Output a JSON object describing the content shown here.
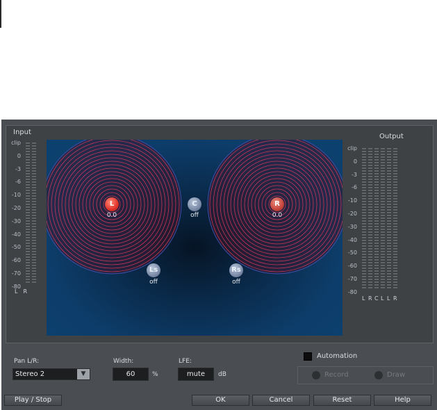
{
  "input": {
    "title": "Input",
    "scale": [
      "clip",
      "0",
      "-3",
      "-6",
      "-10",
      "-20",
      "-30",
      "-40",
      "-50",
      "-60",
      "-70",
      "-80"
    ],
    "left_label": "L",
    "right_label": "R"
  },
  "output": {
    "title": "Output",
    "scale": [
      "clip",
      "0",
      "-3",
      "-6",
      "-10",
      "-20",
      "-30",
      "-40",
      "-50",
      "-60",
      "-70",
      "-80"
    ],
    "channels": [
      "L",
      "R",
      "C",
      "L",
      "L",
      "R"
    ]
  },
  "panner": {
    "channels": {
      "L": {
        "label": "L",
        "value": "0.0"
      },
      "R": {
        "label": "R",
        "value": "0.0"
      },
      "C": {
        "label": "C",
        "value": "off"
      },
      "Ls": {
        "label": "Ls",
        "value": "off"
      },
      "Rs": {
        "label": "Rs",
        "value": "off"
      }
    }
  },
  "controls": {
    "pan_label": "Pan L/R:",
    "pan_value": "Stereo 2",
    "width_label": "Width:",
    "width_value": "60",
    "width_unit": "%",
    "lfe_label": "LFE:",
    "lfe_value": "mute",
    "lfe_unit": "dB"
  },
  "automation": {
    "label": "Automation",
    "record": "Record",
    "draw": "Draw"
  },
  "buttons": {
    "play_stop": "Play / Stop",
    "ok": "OK",
    "cancel": "Cancel",
    "reset": "Reset",
    "help": "Help"
  }
}
